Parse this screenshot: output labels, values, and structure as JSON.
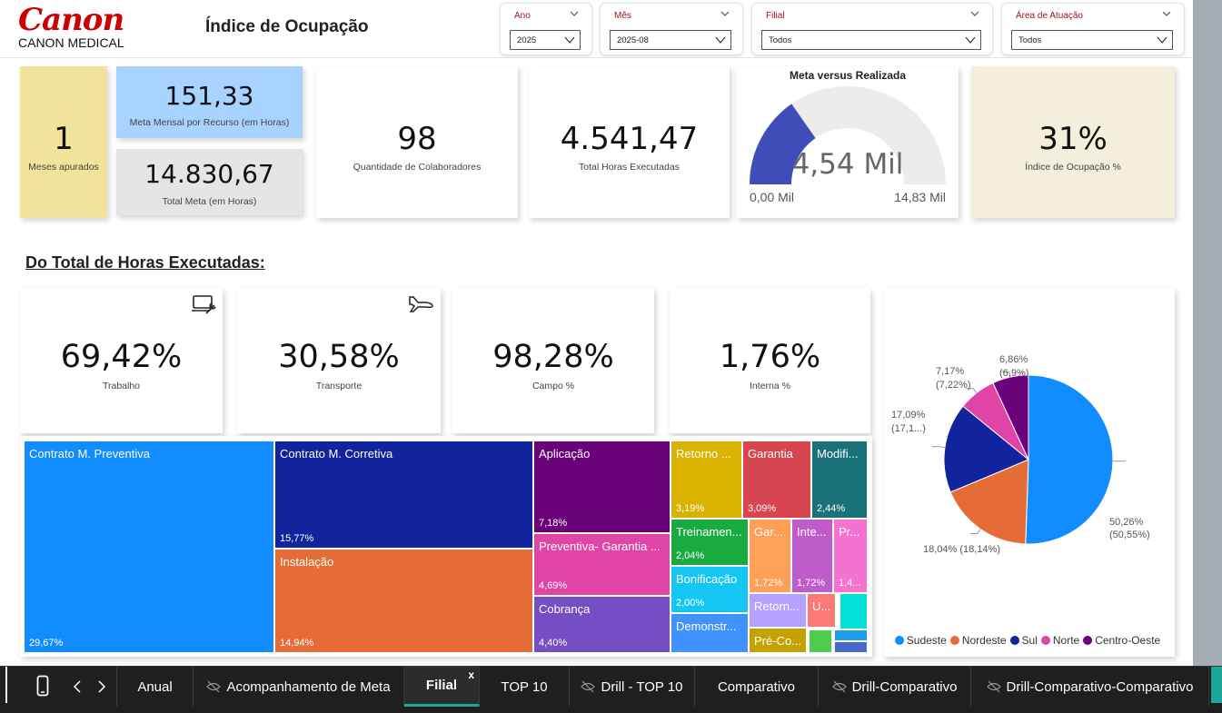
{
  "header": {
    "logo": "Canon",
    "logo_sub": "CANON MEDICAL",
    "title": "Índice de Ocupação"
  },
  "slicers": [
    {
      "title": "Ano",
      "value": "2025"
    },
    {
      "title": "Mês",
      "value": "2025-08"
    },
    {
      "title": "Filial",
      "value": "Todos"
    },
    {
      "title": "Área de Atuação",
      "value": "Todos"
    }
  ],
  "kpis": {
    "meses": {
      "value": "1",
      "label": "Meses apurados"
    },
    "meta_mensal": {
      "value": "151,33",
      "label": "Meta Mensal por Recurso (em Horas)"
    },
    "total_meta": {
      "value": "14.830,67",
      "label": "Total Meta (em Horas)"
    },
    "colaboradores": {
      "value": "98",
      "label": "Quantidade de Colaboradores"
    },
    "horas": {
      "value": "4.541,47",
      "label": "Total Horas Executadas"
    },
    "gauge": {
      "title": "Meta versus Realizada",
      "value_text": "4,54 Mil",
      "min_text": "0,00 Mil",
      "max_text": "14,83 Mil",
      "value": 4541.47,
      "min": 0,
      "max": 14830.67
    },
    "indice": {
      "value": "31%",
      "label": "Índice de Ocupação %"
    }
  },
  "section_title": "Do Total de Horas Executadas:",
  "pct_cards": [
    {
      "value": "69,42%",
      "label": "Trabalho",
      "icon": "laptop-wrench-icon"
    },
    {
      "value": "30,58%",
      "label": "Transporte",
      "icon": "airplane-icon"
    },
    {
      "value": "98,28%",
      "label": "Campo %"
    },
    {
      "value": "1,76%",
      "label": "Interna %"
    }
  ],
  "treemap": [
    {
      "name": "Contrato M. Preventiva",
      "pct": "29,67%",
      "color": "#118dff"
    },
    {
      "name": "Contrato M. Corretiva",
      "pct": "15,77%",
      "color": "#12239e"
    },
    {
      "name": "Instalação",
      "pct": "14,94%",
      "color": "#e66c37"
    },
    {
      "name": "Aplicação",
      "pct": "7,18%",
      "color": "#6b007b"
    },
    {
      "name": "Preventiva- Garantia ...",
      "pct": "4,69%",
      "color": "#e044a7"
    },
    {
      "name": "Cobrança",
      "pct": "4,40%",
      "color": "#744ec2"
    },
    {
      "name": "Retorno ...",
      "pct": "3,19%",
      "color": "#d9b300"
    },
    {
      "name": "Garantia",
      "pct": "3,09%",
      "color": "#d64550"
    },
    {
      "name": "Modifi...",
      "pct": "2,44%",
      "color": "#197278"
    },
    {
      "name": "Treinamen...",
      "pct": "2,04%",
      "color": "#1aab40"
    },
    {
      "name": "Bonificação",
      "pct": "2,00%",
      "color": "#15c6f4"
    },
    {
      "name": "Demonstr...",
      "pct": "",
      "color": "#4092ff"
    },
    {
      "name": "Gar...",
      "pct": "1,72%",
      "color": "#ffa058"
    },
    {
      "name": "Inte...",
      "pct": "1,72%",
      "color": "#be5dc9"
    },
    {
      "name": "Pr...",
      "pct": "1,4...",
      "color": "#f472d0"
    },
    {
      "name": "Retorn...",
      "pct": "",
      "color": "#b5a1ff"
    },
    {
      "name": "U...",
      "pct": "",
      "color": "#fd7976"
    },
    {
      "name": "Pré-Co...",
      "pct": "",
      "color": "#c4a200"
    },
    {
      "name": "",
      "pct": "",
      "color": "#05e0db"
    },
    {
      "name": "",
      "pct": "",
      "color": "#4ecc4e"
    },
    {
      "name": "",
      "pct": "",
      "color": "#1f9ee5"
    },
    {
      "name": "",
      "pct": "",
      "color": "#4a68c9"
    }
  ],
  "chart_data": {
    "type": "pie",
    "series": [
      {
        "name": "Sudeste",
        "value": 50.26,
        "label": "50,26%",
        "label2": "(50,55%)",
        "color": "#118dff"
      },
      {
        "name": "Nordeste",
        "value": 18.04,
        "label": "18,04% (18,14%)",
        "label2": "",
        "color": "#e66c37"
      },
      {
        "name": "Sul",
        "value": 17.09,
        "label": "17,09%",
        "label2": "(17,1...)",
        "color": "#12239e"
      },
      {
        "name": "Norte",
        "value": 7.17,
        "label": "7,17%",
        "label2": "(7,22%)",
        "color": "#e044a7"
      },
      {
        "name": "Centro-Oeste",
        "value": 6.86,
        "label": "6,86%",
        "label2": "(6,9%)",
        "color": "#6b007b"
      }
    ],
    "legend_position": "bottom"
  },
  "tabs": [
    {
      "label": "Anual",
      "hidden": false,
      "active": false
    },
    {
      "label": "Acompanhamento de Meta",
      "hidden": true,
      "active": false
    },
    {
      "label": "Filial",
      "hidden": false,
      "active": true,
      "close": "x"
    },
    {
      "label": "TOP 10",
      "hidden": false,
      "active": false
    },
    {
      "label": "Drill - TOP 10",
      "hidden": true,
      "active": false
    },
    {
      "label": "Comparativo",
      "hidden": false,
      "active": false
    },
    {
      "label": "Drill-Comparativo",
      "hidden": true,
      "active": false
    },
    {
      "label": "Drill-Comparativo-Comparativo",
      "hidden": true,
      "active": false
    }
  ]
}
